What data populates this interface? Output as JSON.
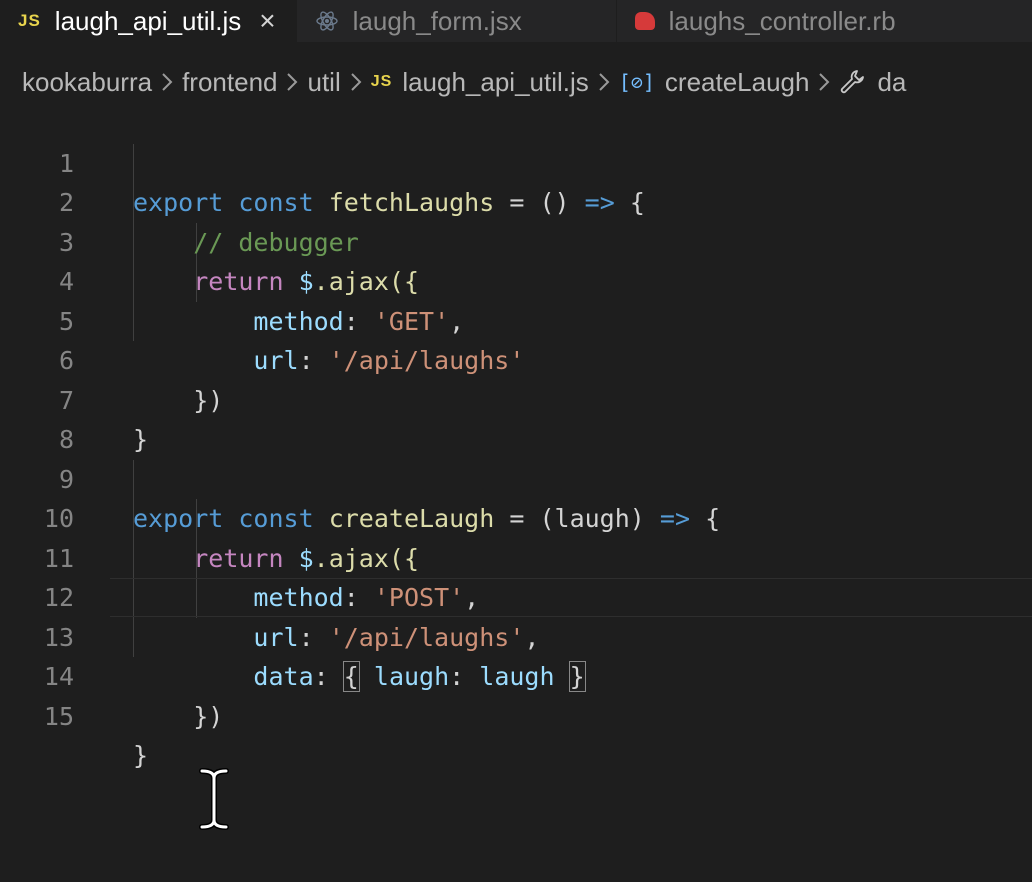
{
  "tabs": [
    {
      "label": "laugh_api_util.js",
      "icon": "js-icon",
      "badge": "JS",
      "active": true
    },
    {
      "label": "laugh_form.jsx",
      "icon": "react-icon",
      "active": false
    },
    {
      "label": "laughs_controller.rb",
      "icon": "ruby-icon",
      "active": false
    }
  ],
  "breadcrumb": {
    "items": [
      "kookaburra",
      "frontend",
      "util",
      "laugh_api_util.js",
      "createLaugh",
      "da"
    ],
    "js_badge": "JS"
  },
  "editor": {
    "line_numbers": [
      "1",
      "2",
      "3",
      "4",
      "5",
      "6",
      "7",
      "8",
      "9",
      "10",
      "11",
      "12",
      "13",
      "14",
      "15"
    ],
    "lines": [
      [
        "export",
        "const",
        "fetchLaughs",
        "=",
        "()",
        "=>",
        "{"
      ],
      [
        "// debugger"
      ],
      [
        "return",
        "$",
        ".ajax({"
      ],
      [
        "method",
        ":",
        "'GET'",
        ","
      ],
      [
        "url",
        ":",
        "'/api/laughs'"
      ],
      [
        "})"
      ],
      [
        "}"
      ],
      [],
      [
        "export",
        "const",
        "createLaugh",
        "=",
        "(laugh)",
        "=>",
        "{"
      ],
      [
        "return",
        "$",
        ".ajax({"
      ],
      [
        "method",
        ":",
        "'POST'",
        ","
      ],
      [
        "url",
        ":",
        "'/api/laughs'",
        ","
      ],
      [
        "data",
        ":",
        "{",
        "laugh",
        ":",
        "laugh",
        "}"
      ],
      [
        "})"
      ],
      [
        "}"
      ]
    ]
  },
  "colors": {
    "background": "#1e1e1e",
    "keyword": "#569cd6",
    "control": "#c586c0",
    "function": "#dcdcaa",
    "property": "#9cdcfe",
    "string": "#ce9178",
    "comment": "#6a9955",
    "js_badge": "#e8d44d"
  }
}
